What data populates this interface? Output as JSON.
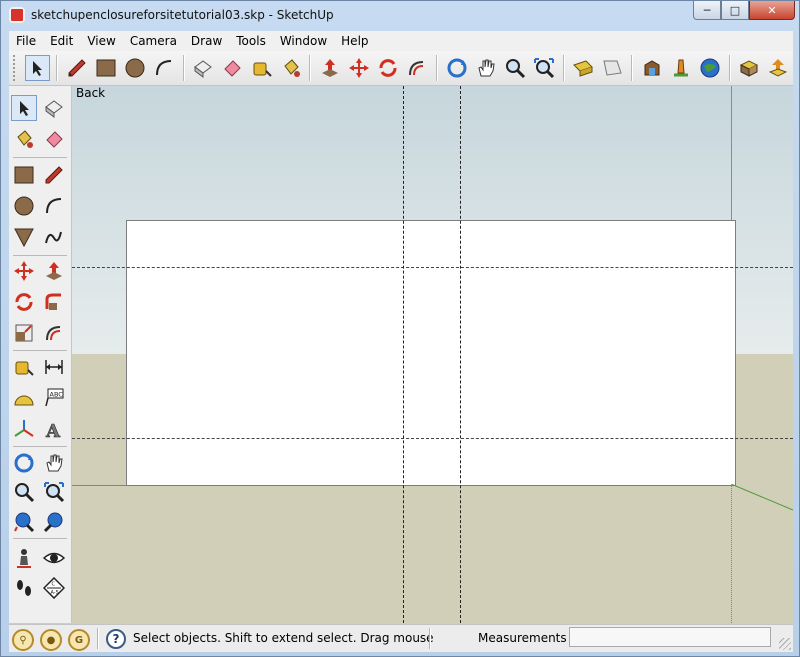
{
  "window": {
    "title": "sketchupenclosureforsitetutorial03.skp - SketchUp"
  },
  "menu": [
    {
      "key": "file",
      "label": "File"
    },
    {
      "key": "edit",
      "label": "Edit"
    },
    {
      "key": "view",
      "label": "View"
    },
    {
      "key": "camera",
      "label": "Camera"
    },
    {
      "key": "draw",
      "label": "Draw"
    },
    {
      "key": "tools",
      "label": "Tools"
    },
    {
      "key": "window",
      "label": "Window"
    },
    {
      "key": "help",
      "label": "Help"
    }
  ],
  "viewport": {
    "view_name": "Back"
  },
  "status": {
    "message": "Select objects. Shift to extend select. Drag mouse",
    "measurements_label": "Measurements",
    "measurements_value": ""
  },
  "colors": {
    "sky": "#c6d6dc",
    "ground": "#d2cfb9",
    "face": "#ffffff",
    "blue_axis": "#7c86d8",
    "red_axis": "#cc6666",
    "green_axis": "#59a359"
  }
}
